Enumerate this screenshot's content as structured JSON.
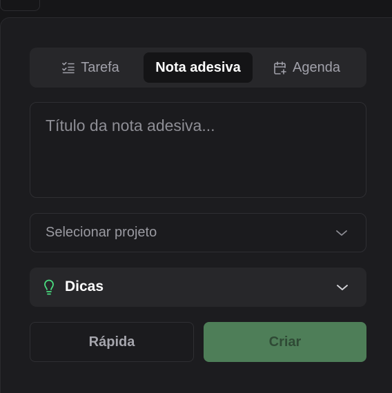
{
  "tabs": [
    {
      "label": "Tarefa",
      "icon": "checklist-icon",
      "active": false
    },
    {
      "label": "Nota adesiva",
      "icon": "",
      "active": true
    },
    {
      "label": "Agenda",
      "icon": "calendar-plus-icon",
      "active": false
    }
  ],
  "note": {
    "title_placeholder": "Título da nota adesiva...",
    "title_value": ""
  },
  "project": {
    "placeholder": "Selecionar projeto"
  },
  "tips": {
    "label": "Dicas",
    "icon": "lightbulb-icon",
    "icon_color": "#4ade80"
  },
  "actions": {
    "quick_label": "Rápida",
    "create_label": "Criar",
    "create_color": "#4e7e58"
  }
}
